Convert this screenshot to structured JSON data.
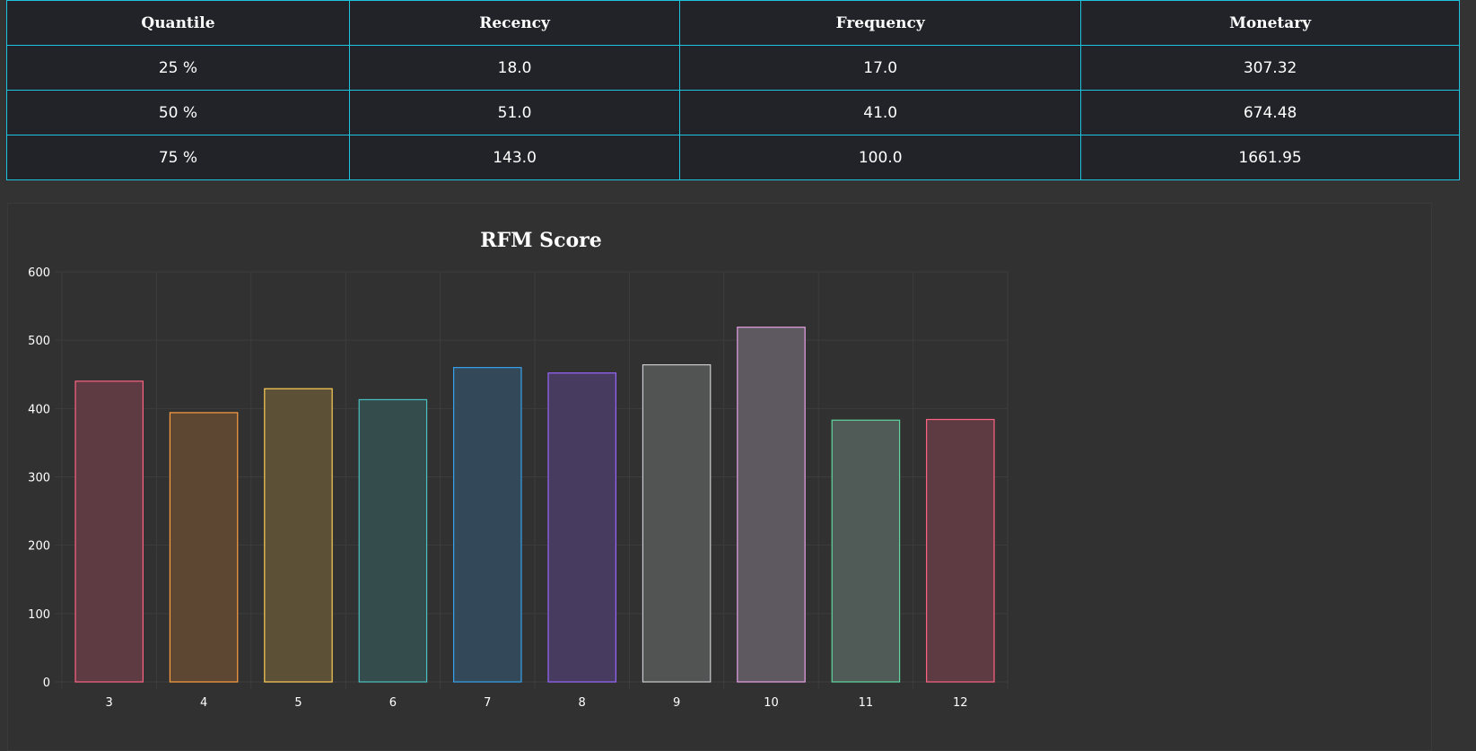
{
  "table": {
    "headers": [
      "Quantile",
      "Recency",
      "Frequency",
      "Monetary"
    ],
    "rows": [
      [
        "25 %",
        "18.0",
        "17.0",
        "307.32"
      ],
      [
        "50 %",
        "51.0",
        "41.0",
        "674.48"
      ],
      [
        "75 %",
        "143.0",
        "100.0",
        "1661.95"
      ]
    ]
  },
  "chart_data": {
    "type": "bar",
    "title": "RFM Score",
    "categories": [
      "3",
      "4",
      "5",
      "6",
      "7",
      "8",
      "9",
      "10",
      "11",
      "12"
    ],
    "values": [
      440,
      394,
      429,
      413,
      460,
      452,
      464,
      519,
      383,
      384
    ],
    "ylim": [
      0,
      600
    ],
    "yticks": [
      0,
      100,
      200,
      300,
      400,
      500,
      600
    ],
    "grid": true,
    "legend": "none",
    "colors": {
      "border": [
        "#ff6384",
        "#ff9f40",
        "#ffcd56",
        "#4bc0c0",
        "#36a2eb",
        "#9966ff",
        "#c9cbcf",
        "#e9a0e8",
        "#5fd6a0",
        "#ff6384"
      ],
      "fill": [
        "#5e3a43",
        "#5d4733",
        "#5c5037",
        "#354c4c",
        "#334858",
        "#473b5f",
        "#525353",
        "#5e5960",
        "#505b58",
        "#5e3a43"
      ]
    }
  }
}
